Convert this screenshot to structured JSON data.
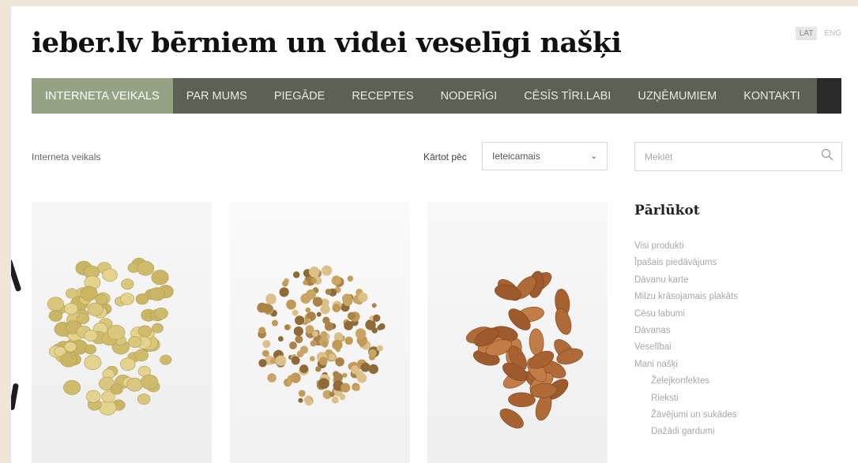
{
  "header": {
    "site_title": "ieber.lv bērniem un videi veselīgi našķi",
    "languages": [
      {
        "label": "LAT",
        "active": true
      },
      {
        "label": "ENG",
        "active": false
      }
    ]
  },
  "nav": {
    "items": [
      {
        "label": "INTERNETA VEIKALS",
        "active": true
      },
      {
        "label": "PAR MUMS"
      },
      {
        "label": "PIEGĀDE"
      },
      {
        "label": "RECEPTES"
      },
      {
        "label": "NODERĪGI"
      },
      {
        "label": "CĒSĪS TĪRI.LABI"
      },
      {
        "label": "UZŅĒMUMIEM"
      },
      {
        "label": "KONTAKTI"
      }
    ]
  },
  "breadcrumb": "Interneta veikals",
  "sort": {
    "label": "Kārtot pēc",
    "selected": "Ieteicamais"
  },
  "search": {
    "placeholder": "Meklēt"
  },
  "products": [
    {
      "image": "yellow-peas-photo"
    },
    {
      "image": "dried-mulberries-photo"
    },
    {
      "image": "almonds-photo"
    }
  ],
  "sidebar": {
    "title": "Pārlūkot",
    "items": [
      {
        "label": "Visi produkti"
      },
      {
        "label": "Īpašais piedāvājums"
      },
      {
        "label": "Dāvanu karte"
      },
      {
        "label": "Milzu krāsojamais plakāts"
      },
      {
        "label": "Cēsu labumi"
      },
      {
        "label": "Dāvanas"
      },
      {
        "label": "Veselībai"
      },
      {
        "label": "Mani našķi"
      },
      {
        "label": "Želejkonfektes"
      },
      {
        "label": "Rieksti"
      },
      {
        "label": "Žāvējumi un sukādes"
      },
      {
        "label": "Dažādi gardumi"
      }
    ]
  },
  "colors": {
    "nav_bg": "#5b6153",
    "nav_active": "#95a283",
    "background": "#efe6d8"
  }
}
